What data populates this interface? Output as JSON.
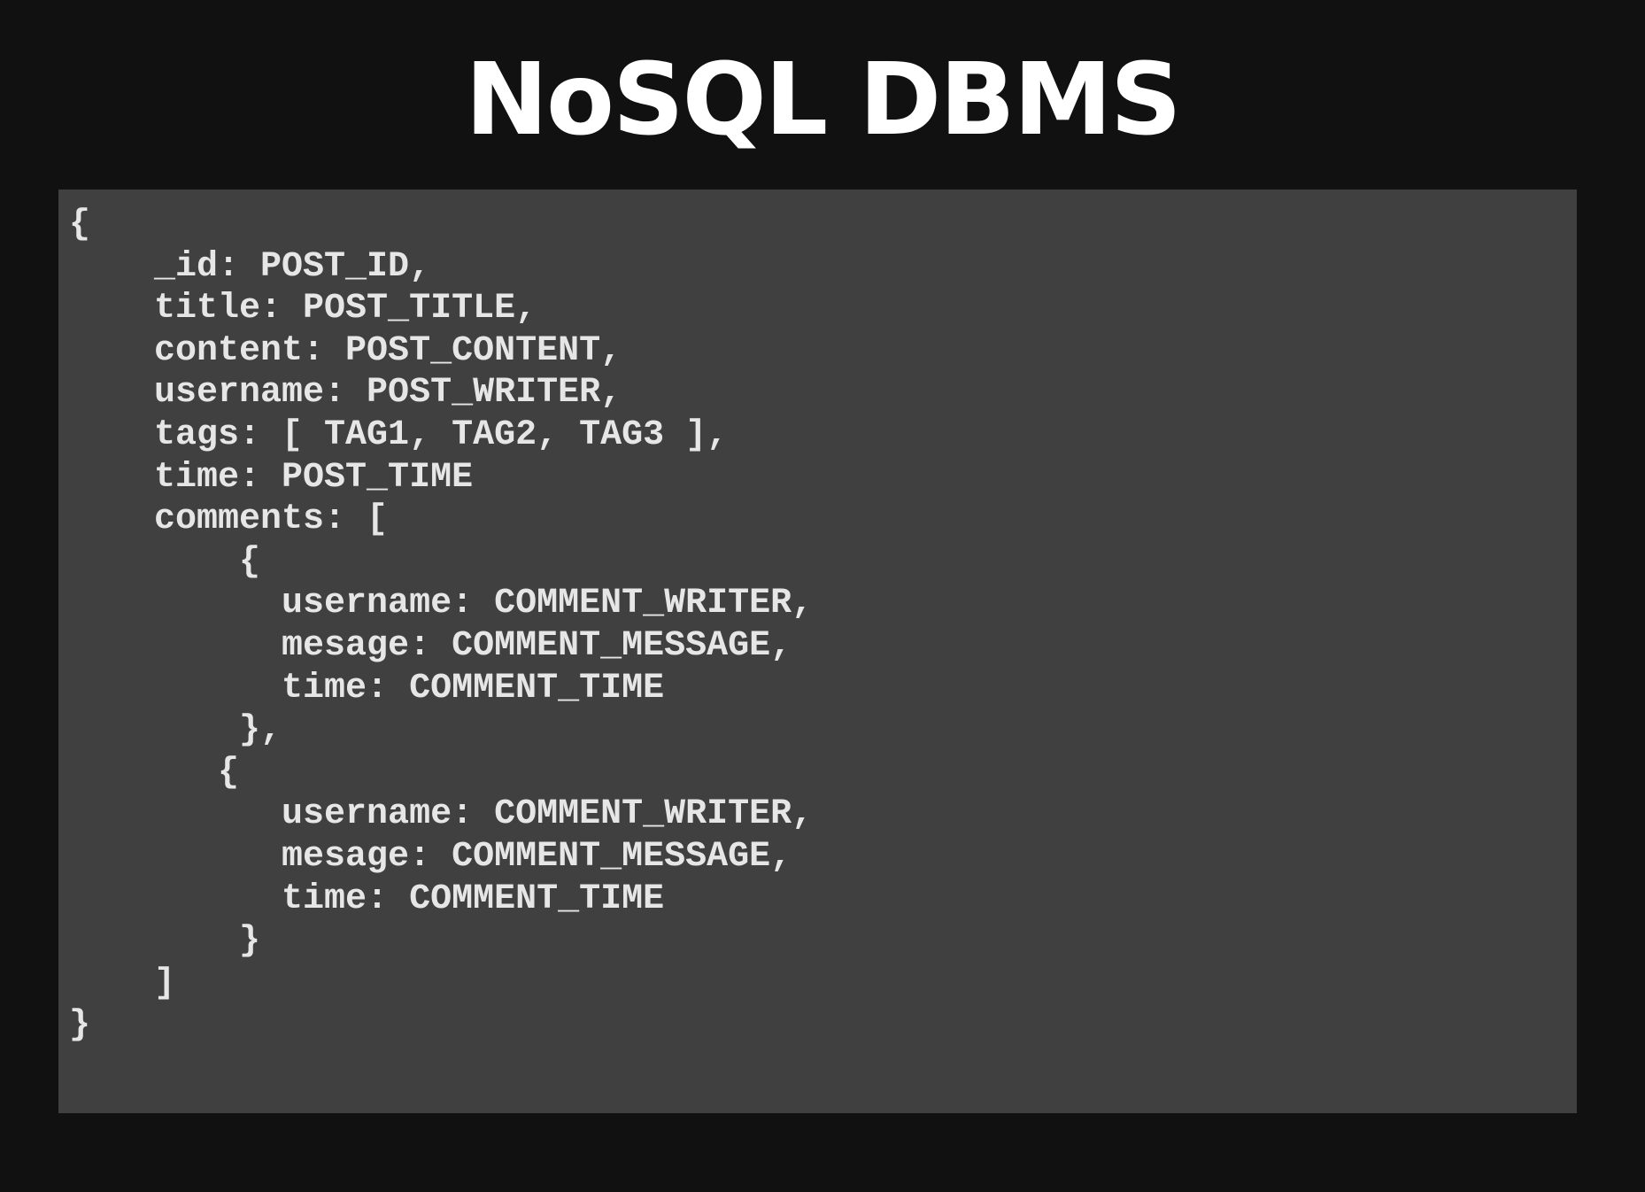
{
  "slide": {
    "title": "NoSQL DBMS"
  },
  "code": {
    "lines": [
      "{",
      "    _id: POST_ID,",
      "    title: POST_TITLE,",
      "    content: POST_CONTENT,",
      "    username: POST_WRITER,",
      "    tags: [ TAG1, TAG2, TAG3 ],",
      "    time: POST_TIME",
      "    comments: [",
      "        {",
      "          username: COMMENT_WRITER,",
      "          mesage: COMMENT_MESSAGE,",
      "          time: COMMENT_TIME",
      "        },",
      "       {",
      "          username: COMMENT_WRITER,",
      "          mesage: COMMENT_MESSAGE,",
      "          time: COMMENT_TIME",
      "        }",
      "    ]",
      "}"
    ]
  }
}
